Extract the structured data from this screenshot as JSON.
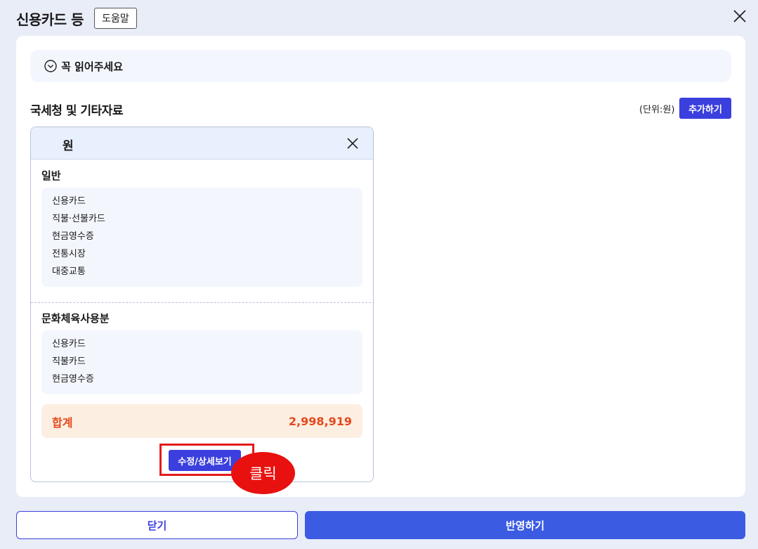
{
  "header": {
    "title": "신용카드 등",
    "help_label": "도움말"
  },
  "notice": {
    "label": "꼭 읽어주세요",
    "icon": "chevron-down-circle-icon"
  },
  "section": {
    "title": "국세청 및 기타자료",
    "unit": "(단위:원)",
    "add_label": "추가하기"
  },
  "card": {
    "unit_label": "원",
    "general": {
      "title": "일반",
      "items": [
        "신용카드",
        "직불·선불카드",
        "현금영수증",
        "전통시장",
        "대중교통"
      ]
    },
    "culture": {
      "title": "문화체육사용분",
      "items": [
        "신용카드",
        "직불카드",
        "현금영수증"
      ]
    },
    "total_label": "합계",
    "total_value": "2,998,919",
    "edit_label": "수정/상세보기"
  },
  "annotation": {
    "click_label": "클릭",
    "highlight_color": "#e31b1b"
  },
  "footer": {
    "close_label": "닫기",
    "apply_label": "반영하기"
  },
  "colors": {
    "accent": "#3b3fde",
    "apply": "#3b5be3",
    "total_text": "#e34a1c"
  }
}
